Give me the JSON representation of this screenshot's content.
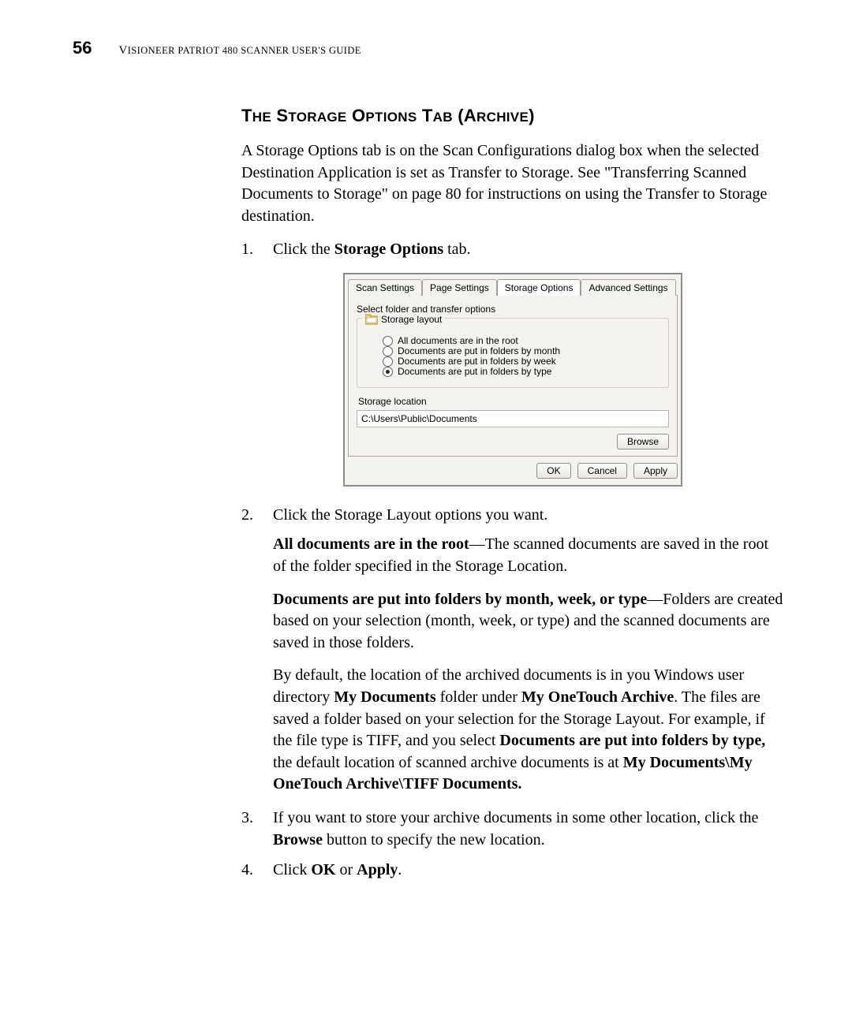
{
  "header": {
    "page_number": "56",
    "running_head_left": "V",
    "running_head_rest": "ISIONEER PATRIOT 480 SCANNER USER'S GUIDE"
  },
  "section": {
    "title_parts": [
      "T",
      "HE",
      " S",
      "TORAGE",
      " O",
      "PTIONS",
      " T",
      "AB",
      " (A",
      "RCHIVE",
      ")"
    ]
  },
  "intro": "A Storage Options tab is on the Scan Configurations dialog box when the selected Destination Application is set as Transfer to Storage. See \"Transferring Scanned Documents to Storage\" on page 80 for instructions on using the Transfer to Storage destination.",
  "steps": {
    "s1_num": "1.",
    "s1_pre": "Click the ",
    "s1_bold": "Storage Options",
    "s1_post": " tab.",
    "s2_num": "2.",
    "s2_text": "Click the Storage Layout options you want.",
    "s2a_bold": "All documents are in the root",
    "s2a_rest": "—The scanned documents are saved in the root of the folder specified in the Storage Location.",
    "s2b_bold": "Documents are put into folders by month, week, or type",
    "s2b_rest": "—Folders are created based on your selection (month, week, or type) and the scanned documents are saved in those folders.",
    "s2c_p1a": "By default, the location of the archived documents is in you Windows user directory ",
    "s2c_p1b": "My Documents",
    "s2c_p1c": " folder under ",
    "s2c_p1d": "My OneTouch Archive",
    "s2c_p1e": ". The files are saved a folder based on your selection for the Storage Layout. For example, if the file type is TIFF, and you select ",
    "s2c_p1f": "Documents are put into folders by type,",
    "s2c_p1g": " the default location of scanned archive documents is at ",
    "s2c_p1h": "My Documents\\My OneTouch Archive\\TIFF Documents.",
    "s3_num": "3.",
    "s3_a": "If you want to store your archive documents in some other location, click the ",
    "s3_b": "Browse",
    "s3_c": " button to specify the new location.",
    "s4_num": "4.",
    "s4_a": "Click ",
    "s4_b": "OK",
    "s4_c": " or ",
    "s4_d": "Apply",
    "s4_e": "."
  },
  "dialog": {
    "tabs": {
      "scan": "Scan Settings",
      "page": "Page Settings",
      "storage": "Storage Options",
      "advanced": "Advanced Settings"
    },
    "group_label": "Select folder and transfer options",
    "layout_legend": "Storage layout",
    "radios": {
      "root": "All documents are in the root",
      "month": "Documents are put in folders by month",
      "week": "Documents are put in folders by week",
      "type": "Documents are put in folders by type"
    },
    "selected_radio": "type",
    "location_label": "Storage location",
    "location_path": "C:\\Users\\Public\\Documents",
    "browse": "Browse",
    "ok": "OK",
    "cancel": "Cancel",
    "apply": "Apply"
  }
}
